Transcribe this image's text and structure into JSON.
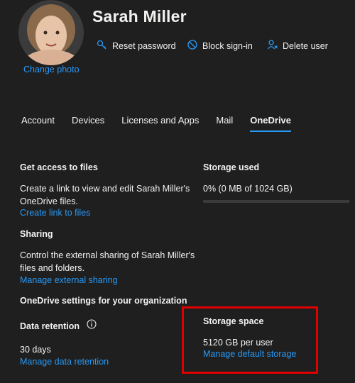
{
  "user": {
    "name": "Sarah Miller",
    "change_photo": "Change photo"
  },
  "actions": {
    "reset_password": "Reset password",
    "block_sign_in": "Block sign-in",
    "delete_user": "Delete user"
  },
  "tabs": [
    {
      "label": "Account"
    },
    {
      "label": "Devices"
    },
    {
      "label": "Licenses and Apps"
    },
    {
      "label": "Mail"
    },
    {
      "label": "OneDrive",
      "active": true
    }
  ],
  "get_access": {
    "heading": "Get access to files",
    "description": "Create a link to view and edit Sarah Miller's OneDrive files.",
    "link": "Create link to files"
  },
  "sharing": {
    "heading": "Sharing",
    "description": "Control the external sharing of Sarah Miller's files and folders.",
    "link": "Manage external sharing"
  },
  "org_settings": {
    "heading": "OneDrive settings for your organization"
  },
  "data_retention": {
    "heading": "Data retention",
    "value": "30 days",
    "link": "Manage data retention"
  },
  "storage_used": {
    "heading": "Storage used",
    "value": "0% (0 MB of 1024 GB)",
    "percent": 0
  },
  "storage_space": {
    "heading": "Storage space",
    "value": "5120 GB per user",
    "link": "Manage default storage"
  },
  "colors": {
    "background": "#1f1f1f",
    "accent": "#2899f5",
    "highlight": "#e00000"
  }
}
